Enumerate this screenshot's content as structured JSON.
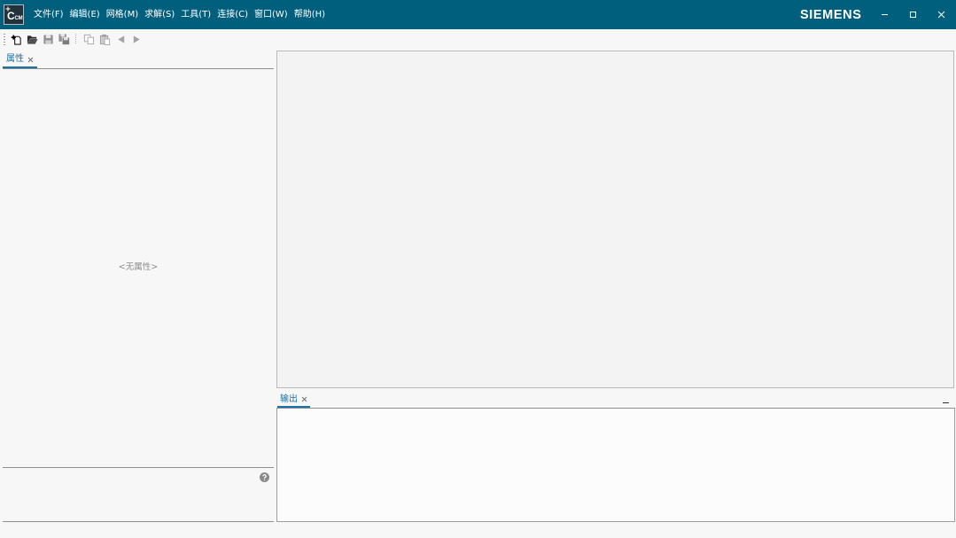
{
  "window": {
    "app_icon_text": "CCM",
    "app_icon_name": "star-ccm-app-icon",
    "menu": [
      "文件(F)",
      "编辑(E)",
      "网格(M)",
      "求解(S)",
      "工具(T)",
      "连接(C)",
      "窗口(W)",
      "帮助(H)"
    ],
    "brand": "SIEMENS",
    "controls": [
      "minimize-icon",
      "maximize-icon",
      "close-icon"
    ]
  },
  "toolbar": {
    "buttons": [
      {
        "icon": "new-simulation-icon",
        "enabled": true
      },
      {
        "icon": "open-folder-icon",
        "enabled": true
      },
      {
        "icon": "save-icon",
        "enabled": false
      },
      {
        "icon": "save-as-icon",
        "enabled": false
      },
      {
        "icon": "copy-icon",
        "enabled": false
      },
      {
        "icon": "paste-icon",
        "enabled": false
      },
      {
        "icon": "back-arrow-icon",
        "enabled": false
      },
      {
        "icon": "forward-arrow-icon",
        "enabled": false
      }
    ]
  },
  "properties_panel": {
    "tab_label": "属性",
    "tab_close_icon": "close-icon",
    "empty_text": "<无属性>",
    "help_icon": "help-icon"
  },
  "output_panel": {
    "tab_label": "输出",
    "tab_close_icon": "close-icon",
    "minimize_icon": "minimize-icon"
  },
  "colors": {
    "title_bar": "#005f7d",
    "tab_accent": "#1b72a8",
    "disabled_icon": "#9a9a9a",
    "background": "#f7f7f7"
  }
}
